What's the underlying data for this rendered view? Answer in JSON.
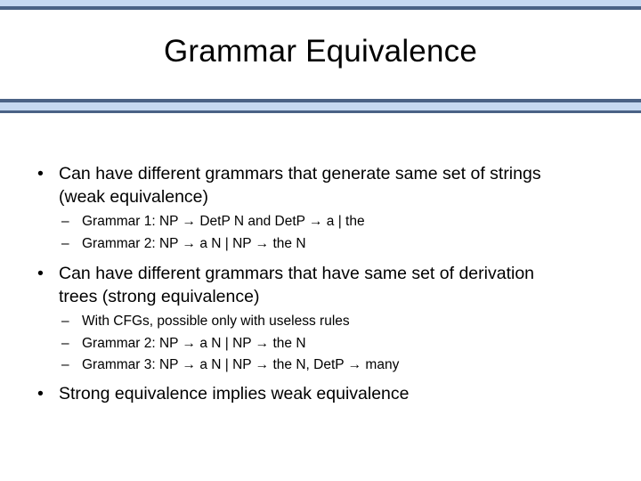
{
  "slide": {
    "title": "Grammar Equivalence",
    "bullet_char": "•",
    "dash_char": "–",
    "accent_fill": "#c6d9f1",
    "accent_border": "#4a6285",
    "text_color": "#000000",
    "background": "#ffffff",
    "content": [
      {
        "level": 1,
        "text": "Can have different grammars that generate same set of strings (weak equivalence)"
      },
      {
        "level": 2,
        "text": "Grammar 1: NP → DetP N and DetP →  a | the"
      },
      {
        "level": 2,
        "text": "Grammar 2: NP → a N | NP → the N"
      },
      {
        "level": 1,
        "text": "Can have different grammars that have same set of derivation trees (strong equivalence)"
      },
      {
        "level": 2,
        "text": "With CFGs, possible only with useless rules"
      },
      {
        "level": 2,
        "text": "Grammar 2: NP → a N | NP → the N"
      },
      {
        "level": 2,
        "text": "Grammar 3: NP → a N | NP → the N, DetP → many"
      },
      {
        "level": 1,
        "text": "Strong equivalence implies weak equivalence"
      }
    ]
  }
}
